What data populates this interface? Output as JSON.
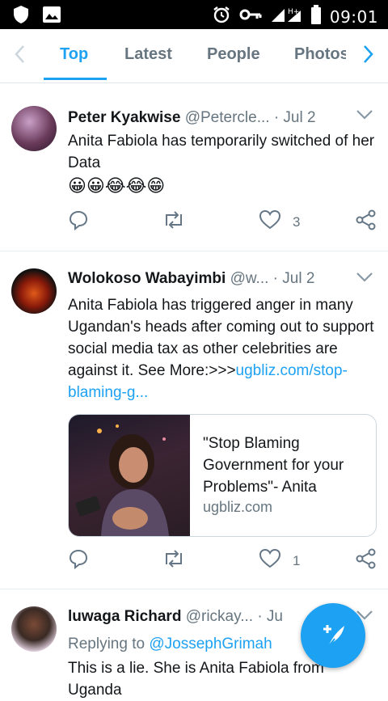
{
  "status": {
    "time": "09:01",
    "network": "H+"
  },
  "tabs": [
    {
      "label": "Top",
      "active": true
    },
    {
      "label": "Latest"
    },
    {
      "label": "People"
    },
    {
      "label": "Photos"
    }
  ],
  "tweets": [
    {
      "name": "Peter Kyakwise",
      "handle": "@Petercle...",
      "date": "· Jul 2",
      "text": "Anita Fabiola has temporarily switched of her Data",
      "emoji": "😀😀😂😂😁",
      "likes": "3"
    },
    {
      "name": "Wolokoso Wabayimbi",
      "handle": "@w...",
      "date": "· Jul 2",
      "text": "Anita Fabiola has triggered anger in many Ugandan's heads after coming out to support social media tax as other celebrities are against it. See More:>>>",
      "link": "ugbliz.com/stop-blaming-g...",
      "card": {
        "title": "\"Stop Blaming Government for your Problems\"- Anita",
        "domain": "ugbliz.com"
      },
      "likes": "1"
    },
    {
      "name": "luwaga Richard",
      "handle": "@rickay...",
      "date": "· Ju",
      "reply_prefix": "Replying to",
      "reply_to": "@JossephGrimah",
      "text": "This is a lie. She is Anita Fabiola from Uganda"
    }
  ],
  "colors": {
    "accent": "#1da1f2",
    "secondary_text": "#66757f",
    "divider": "#e6ecf0"
  }
}
